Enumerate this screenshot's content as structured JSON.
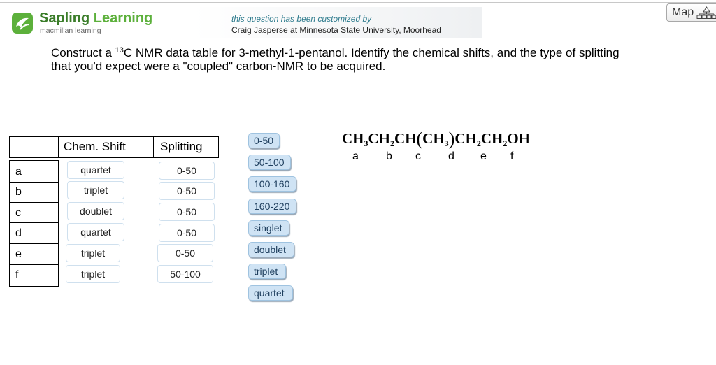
{
  "header": {
    "brand_first": "Sapling",
    "brand_second": "Learning",
    "brand_sub": "macmillan learning",
    "customized_line1": "this question has been customized by",
    "customized_line2": "Craig Jasperse at Minnesota State University, Moorhead"
  },
  "map_button": {
    "label": "Map"
  },
  "question": {
    "pre": "Construct a ",
    "superscript": "13",
    "post_line1": "C NMR data table for 3-methyl-1-pentanol.   Identify the chemical shifts, and the type of splitting",
    "line2": "that you'd expect were a \"coupled\" carbon-NMR to be acquired."
  },
  "table": {
    "headers": [
      "Chem. Shift",
      "Splitting"
    ],
    "rows": [
      {
        "label": "a",
        "col1": "quartet",
        "col2": "0-50"
      },
      {
        "label": "b",
        "col1": "triplet",
        "col2": "0-50"
      },
      {
        "label": "c",
        "col1": "doublet",
        "col2": "0-50"
      },
      {
        "label": "d",
        "col1": "quartet",
        "col2": "0-50"
      },
      {
        "label": "e",
        "col1": "triplet",
        "col2": "0-50"
      },
      {
        "label": "f",
        "col1": "triplet",
        "col2": "50-100"
      }
    ]
  },
  "tiles": [
    "0-50",
    "50-100",
    "100-160",
    "160-220",
    "singlet",
    "doublet",
    "triplet",
    "quartet"
  ],
  "formula": {
    "parts": [
      "CH",
      "3",
      "CH",
      "2",
      "CH",
      "(",
      "CH",
      "3",
      ")",
      "CH",
      "2",
      "CH",
      "2",
      "OH"
    ],
    "letters": [
      "a",
      "b",
      "c",
      "d",
      "e",
      "f"
    ]
  }
}
